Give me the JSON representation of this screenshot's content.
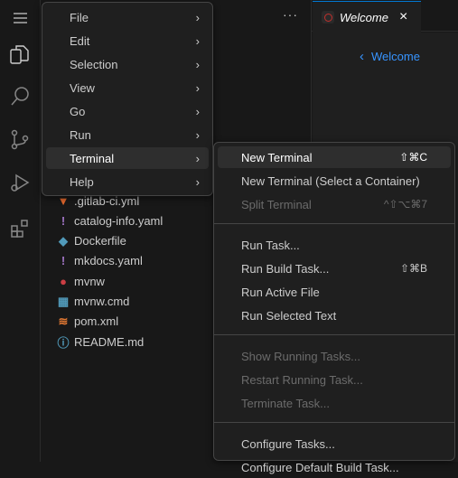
{
  "tab": {
    "title": "Welcome",
    "close": "×"
  },
  "breadcrumb": {
    "label": "Welcome",
    "chevron": "‹"
  },
  "sidebar": {
    "more": "···",
    "files": [
      {
        "name": ".gitlab-ci.yml",
        "icon": "gitlab-icon",
        "color": "#e2672d"
      },
      {
        "name": "catalog-info.yaml",
        "icon": "yaml-icon",
        "color": "#a074c4"
      },
      {
        "name": "Dockerfile",
        "icon": "docker-icon",
        "color": "#519aba"
      },
      {
        "name": "mkdocs.yaml",
        "icon": "yaml-icon",
        "color": "#a074c4"
      },
      {
        "name": "mvnw",
        "icon": "maven-icon",
        "color": "#cc3e44"
      },
      {
        "name": "mvnw.cmd",
        "icon": "windows-icon",
        "color": "#519aba"
      },
      {
        "name": "pom.xml",
        "icon": "rss-icon",
        "color": "#e37933"
      },
      {
        "name": "README.md",
        "icon": "info-icon",
        "color": "#519aba"
      }
    ]
  },
  "menu": {
    "items": [
      "File",
      "Edit",
      "Selection",
      "View",
      "Go",
      "Run",
      "Terminal",
      "Help"
    ],
    "selected": "Terminal"
  },
  "submenu": {
    "groups": [
      [
        {
          "label": "New Terminal",
          "key": "⇧⌘C",
          "selected": true
        },
        {
          "label": "New Terminal (Select a Container)",
          "key": ""
        },
        {
          "label": "Split Terminal",
          "key": "^⇧⌥⌘7",
          "disabled": true
        }
      ],
      [
        {
          "label": "Run Task...",
          "key": ""
        },
        {
          "label": "Run Build Task...",
          "key": "⇧⌘B"
        },
        {
          "label": "Run Active File",
          "key": ""
        },
        {
          "label": "Run Selected Text",
          "key": ""
        }
      ],
      [
        {
          "label": "Show Running Tasks...",
          "key": "",
          "disabled": true
        },
        {
          "label": "Restart Running Task...",
          "key": "",
          "disabled": true
        },
        {
          "label": "Terminate Task...",
          "key": "",
          "disabled": true
        }
      ],
      [
        {
          "label": "Configure Tasks...",
          "key": ""
        },
        {
          "label": "Configure Default Build Task...",
          "key": ""
        }
      ]
    ]
  }
}
